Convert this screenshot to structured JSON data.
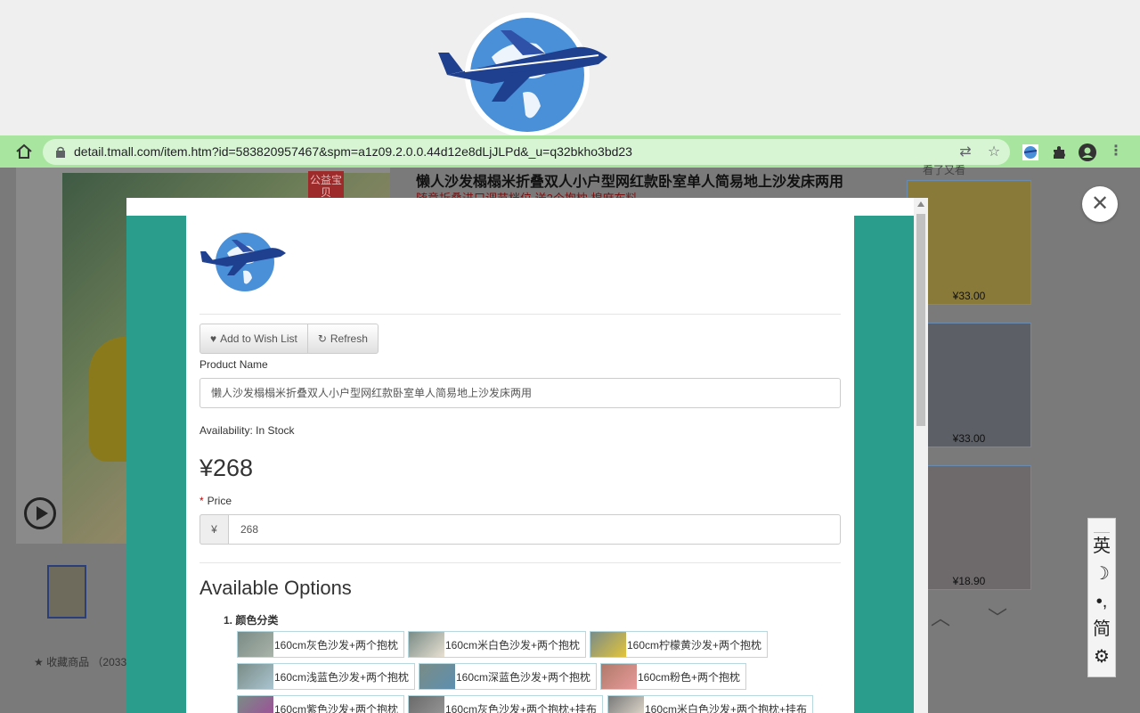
{
  "browser": {
    "url": "detail.tmall.com/item.htm?id=583820957467&spm=a1z09.2.0.0.44d12e8dLjJLPd&_u=q32bkho3bd23"
  },
  "background_page": {
    "title": "懒人沙发榻榻米折叠双人小户型网红款卧室单人简易地上沙发床两用",
    "subtitle": "随意折叠进口调节档位 送2个抱枕 棉麻布料",
    "tag": "公益宝贝",
    "favorite": "收藏商品 （2033",
    "side_heading": "看了又看",
    "side_prices": [
      "¥33.00",
      "¥33.00",
      "¥18.90"
    ]
  },
  "modal": {
    "wishlist_label": "Add to Wish List",
    "refresh_label": "Refresh",
    "product_name_label": "Product Name",
    "product_name_value": "懒人沙发榻榻米折叠双人小户型网红款卧室单人简易地上沙发床两用",
    "availability": "Availability: In Stock",
    "price_display": "¥268",
    "price_label": "Price",
    "price_currency": "¥",
    "price_value": "268",
    "options_title": "Available Options",
    "option_group": "1. 颜色分类",
    "options": [
      "160cm灰色沙发+两个抱枕",
      "160cm米白色沙发+两个抱枕",
      "160cm柠檬黄沙发+两个抱枕",
      "160cm浅蓝色沙发+两个抱枕",
      "160cm深蓝色沙发+两个抱枕",
      "160cm粉色+两个抱枕",
      "160cm紫色沙发+两个抱枕",
      "160cm灰色沙发+两个抱枕+挂布",
      "160cm米白色沙发+两个抱枕+挂布"
    ]
  },
  "ime": {
    "lang": "英",
    "punct": "•,",
    "script": "简"
  },
  "colors": {
    "teal": "#2a9d8c",
    "addressbar": "#a8e6a0"
  }
}
